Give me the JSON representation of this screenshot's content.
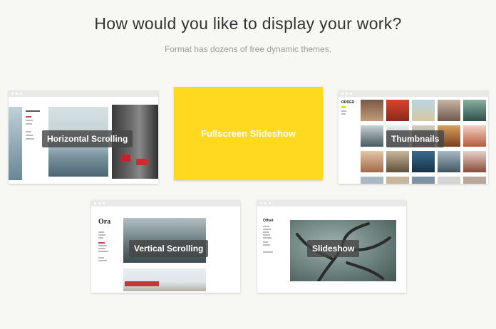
{
  "header": {
    "title": "How would you like to display your work?",
    "subtitle": "Format has dozens of free dynamic themes."
  },
  "themes": [
    {
      "label": "Horizontal Scrolling"
    },
    {
      "label": "Fullscreen Slideshow",
      "color": "#ffd91f"
    },
    {
      "label": "Thumbnails",
      "logo": "ORDER"
    },
    {
      "label": "Vertical Scrolling",
      "logo": "Ora"
    },
    {
      "label": "Slideshow",
      "logo": "Offset"
    }
  ]
}
